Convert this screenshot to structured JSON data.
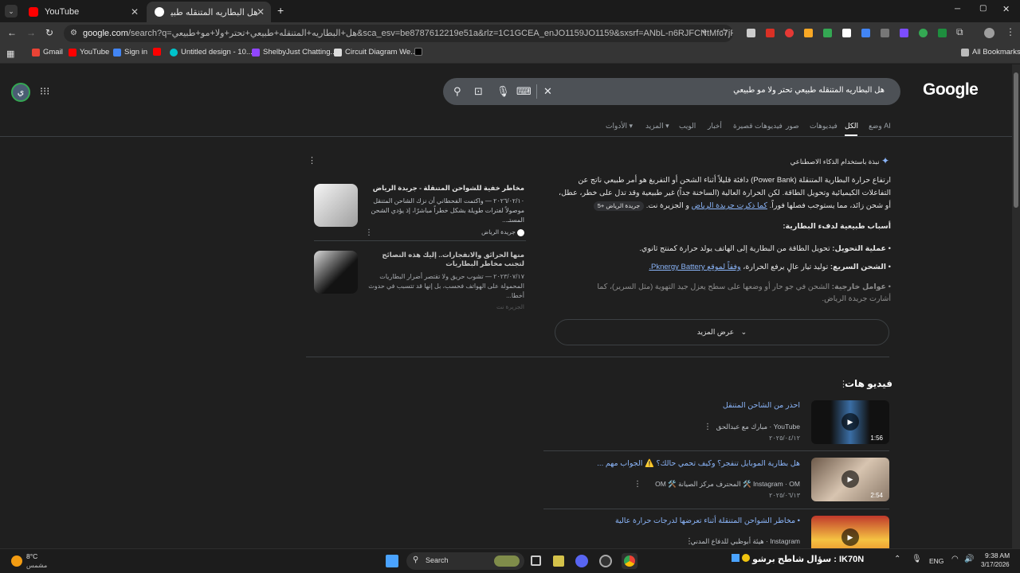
{
  "browser": {
    "tabs": [
      {
        "title": "YouTube",
        "active": false
      },
      {
        "title": "هل البطاريه المتنقله طبيعي تحتر",
        "active": true
      }
    ],
    "new_tab": "+",
    "url_domain": "google.com",
    "url_rest": "/search?q=هل+البطاريه+المتنقله+طبيعي+تحتر+ولا+مو+طبيعي&sca_esv=be8787612219e51a&rlz=1C1GCEA_enJO1159JO1159&sxsrf=ANbL-n6RJFCNtMfc7jFEPRiRiMRP3Gj...",
    "window_controls": {
      "minimize": "─",
      "maximize": "▢",
      "close": "✕"
    }
  },
  "bookmarks": {
    "items": [
      "Gmail",
      "YouTube",
      "Sign in",
      "",
      "Untitled design - 10...",
      "ShelbyJust Chatting...",
      "Circuit Diagram We...",
      ""
    ],
    "all": "All Bookmarks"
  },
  "google": {
    "logo": "Google",
    "query": "هل البطاريه المتنقله طبيعي تحتر ولا مو طبيعي",
    "avatar": "ي",
    "tabs": [
      "وضع AI",
      "الكل",
      "فيديوهات",
      "صور",
      "فيديوهات قصيرة",
      "أخبار",
      "الويب",
      "المزيد ▾",
      "الأدوات ▾"
    ],
    "active_tab": "الكل"
  },
  "ai_overview": {
    "heading": "نبذة باستخدام الذكاء الاصطناعي",
    "paragraph": "ارتفاع حرارة البطارية المتنقلة (Power Bank) دافئة قليلاً أثناء الشحن أو التفريغ هو أمر طبيعي ناتج عن التفاعلات الكيميائية وتحويل الطاقة. لكن الحرارة العالية (الساخنة جداً) غير طبيعية وقد تدل على خطر، عطل، أو شحن زائد، مما يستوجب فصلها فوراً.",
    "para_link": "كما ذكرت جريدة الرياض",
    "para_tail": "و الجزيرة نت.",
    "chip": "جريدة الرياض +5",
    "causes_title": "أسباب طبيعية لدفء البطارية:",
    "bullets": [
      {
        "label": "عملية التحويل:",
        "text": "تحويل الطاقة من البطارية إلى الهاتف يولد حرارة كمنتج ثانوي."
      },
      {
        "label": "الشحن السريع:",
        "text": "توليد تيار عالٍ يرفع الحرارة،",
        "link": "وفقاً لموقع Pknergy Battery."
      },
      {
        "label": "عوامل خارجية:",
        "text": "الشحن في جو حار أو وضعها على سطح يعزل جيد التهوية (مثل السرير)، كما أشارت جريدة الرياض."
      }
    ],
    "more": "عرض المزيد",
    "cards": [
      {
        "title": "مخاطر خفية للشواحن المتنقلة - جريدة الرياض",
        "date": "٢٠٢٦/٠٢/١٠",
        "snippet": "— واكتمت الفحطاني أن نزك الشاحن المتنقل موصولاً لفترات طويلة بشكل خطراً مباشرًا، إذ يؤدي الشحن المستـ...",
        "source": "جريدة الرياض"
      },
      {
        "title": "منها الحرائق والانفجارات.. إليك هذه النصائح لتجنب مخاطر البطاريات",
        "date": "٢٠٢٣/٠٧/١٧",
        "snippet": "— تشوب حريق ولا تقتصر أضرار البطاريات المحمولة على الهواتف فحسب، بل إنها قد تتسبب في حدوث أخطا...",
        "source": "الجزيرة نت"
      }
    ]
  },
  "videos": {
    "heading": "فيديو هات",
    "items": [
      {
        "title": "احذر من الشاحن المتنقل",
        "platform": "YouTube",
        "channel": "مبارك مع عبدالحق",
        "date": "٢٠٢٥/٠٤/١٢",
        "duration": "1:56"
      },
      {
        "title": "هل بطارية الموبايل تنفجر؟ وكيف تحمي حالك؟ ⚠️ الجواب مهم ...",
        "platform": "Instagram",
        "channel": "OM 🛠️ المحترف مركز الصيانة 🛠️ OM",
        "date": "٢٠٢٥/٠٦/١٣",
        "duration": "2:54"
      },
      {
        "title": "• مخاطر الشواحن المتنقلة أثناء تعرضها لدرجات حرارة عالية",
        "platform": "Instagram",
        "channel": "هيئة أبوظبي للدفاع المدني",
        "date": "",
        "duration": ""
      }
    ]
  },
  "taskbar": {
    "weather_temp": "8°C",
    "weather_desc": "مشمس",
    "search": "Search",
    "ticker": "سؤال شاطح برشو : IK70N",
    "lang": "ENG",
    "time": "9:38 AM",
    "date": "3/17/2026"
  },
  "colors": {
    "accent": "#8ab4f8",
    "background": "#1f1f1f",
    "searchbox": "#4d5156"
  }
}
